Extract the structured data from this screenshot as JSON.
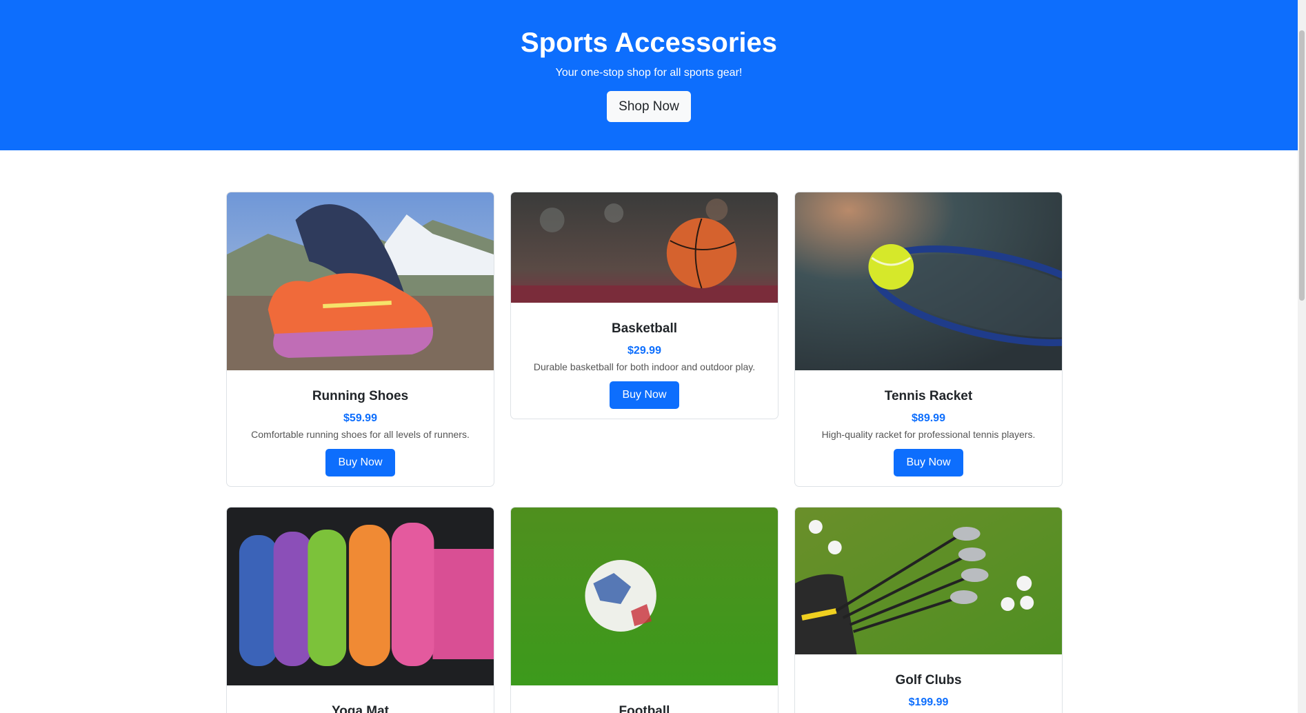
{
  "hero": {
    "title": "Sports Accessories",
    "subtitle": "Your one-stop shop for all sports gear!",
    "cta_label": "Shop Now"
  },
  "colors": {
    "primary": "#0d6efd",
    "hero_bg": "#0d6efd",
    "button_light": "#f8f9fa"
  },
  "products": [
    {
      "name": "Running Shoes",
      "price": "$59.99",
      "description": "Comfortable running shoes for all levels of runners.",
      "button": "Buy Now",
      "image": "running-shoes-image"
    },
    {
      "name": "Basketball",
      "price": "$29.99",
      "description": "Durable basketball for both indoor and outdoor play.",
      "button": "Buy Now",
      "image": "basketball-image"
    },
    {
      "name": "Tennis Racket",
      "price": "$89.99",
      "description": "High-quality racket for professional tennis players.",
      "button": "Buy Now",
      "image": "tennis-racket-image"
    },
    {
      "name": "Yoga Mat",
      "price": "",
      "description": "",
      "button": "",
      "image": "yoga-mat-image"
    },
    {
      "name": "Football",
      "price": "",
      "description": "",
      "button": "",
      "image": "football-image"
    },
    {
      "name": "Golf Clubs",
      "price": "$199.99",
      "description": "",
      "button": "",
      "image": "golf-clubs-image"
    }
  ]
}
